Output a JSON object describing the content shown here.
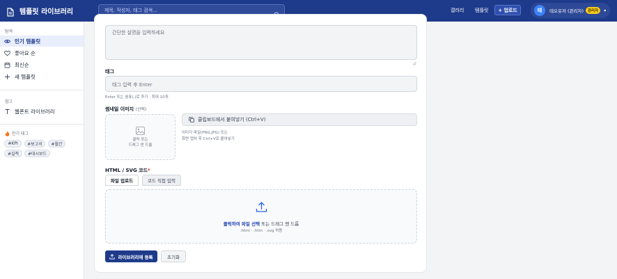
{
  "header": {
    "brand_title": "템플릿 라이브러리",
    "search_placeholder": "제목, 작성자, 태그 검색...",
    "nav_gallery": "갤러리",
    "nav_template": "템플릿",
    "upload_label": "+ 업로드",
    "user_initial": "테",
    "user_name": "테오유저 (관리자)",
    "admin_badge": "관리자",
    "menu_arrow": "▾"
  },
  "sidebar": {
    "explore_label": "탐색",
    "items": [
      {
        "label": "인기 템플릿",
        "icon": "eye-icon",
        "active": true
      },
      {
        "label": "좋아요 순",
        "icon": "heart-icon"
      },
      {
        "label": "최신순",
        "icon": "calendar-icon"
      },
      {
        "label": "새 템플릿",
        "icon": "plus-icon"
      }
    ],
    "reference_label": "참고",
    "font_library": "웹폰트 라이브러리",
    "popular_tags_label": "인기 태그",
    "tags": [
      "#KPI",
      "#보고서",
      "#월간",
      "#실적",
      "#대시보드"
    ]
  },
  "form": {
    "description_placeholder": "간단한 설명을 입력하세요",
    "tags_label": "태그",
    "tags_placeholder": "태그 입력 후 Enter",
    "tags_help": "Enter 또는 쉼표(,)로 추가 · 최대 10개",
    "thumbnail_label": "썸네일 이미지",
    "thumbnail_optional": "(선택)",
    "thumbnail_drop_line1": "클릭 또는",
    "thumbnail_drop_line2": "드래그 앤 드롭",
    "paste_label": "클립보드에서 붙여넣기 (Ctrl+V)",
    "paste_help_line1": "이미지 파일(PNG,JPG) 또는",
    "paste_help_line2": "화면 캡처 후 Ctrl+V로 붙여넣기",
    "code_label": "HTML / SVG 코드",
    "required_mark": "*",
    "tab_file": "파일 업로드",
    "tab_direct": "코드 직접 입력",
    "file_drop_link": "클릭하여 파일 선택",
    "file_drop_rest": " 또는 드래그 앤 드롭",
    "file_drop_formats": ".html · .htm · .svg 허용",
    "submit_label": "라이브러리에 등록",
    "reset_label": "초기화"
  },
  "colors": {
    "header_bg": "#1e3a8a",
    "accent": "#1e3a8a",
    "admin_badge": "#facc15",
    "required": "#dc2626"
  }
}
